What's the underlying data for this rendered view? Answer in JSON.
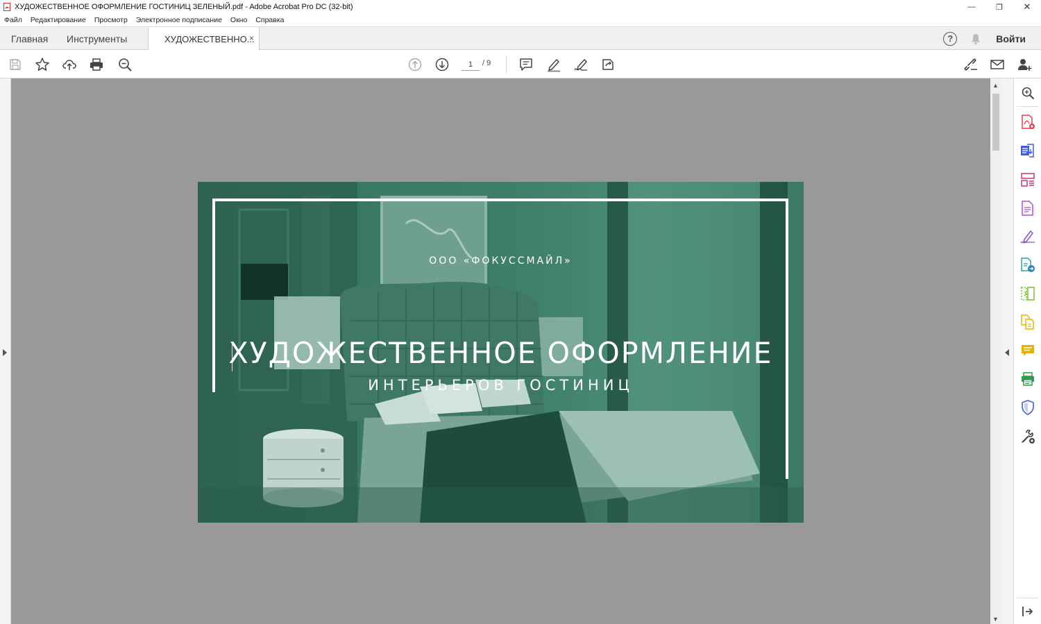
{
  "window": {
    "title": "ХУДОЖЕСТВЕННОЕ ОФОРМЛЕНИЕ ГОСТИНИЦ ЗЕЛЕНЫЙ.pdf - Adobe Acrobat Pro DC (32-bit)",
    "controls": {
      "minimize": "—",
      "restore": "❐",
      "close": "✕"
    }
  },
  "menu": [
    "Файл",
    "Редактирование",
    "Просмотр",
    "Электронное подписание",
    "Окно",
    "Справка"
  ],
  "tabs": {
    "home": "Главная",
    "tools": "Инструменты",
    "document": "ХУДОЖЕСТВЕННО...",
    "close": "×"
  },
  "header_right": {
    "help": "?",
    "login": "Войти"
  },
  "toolbar": {
    "page_current": "1",
    "page_total": "/ 9"
  },
  "pdf": {
    "company": "ООО «ФОКУССМАЙЛ»",
    "headline": "ХУДОЖЕСТВЕННОЕ ОФОРМЛЕНИЕ",
    "subhead": "ИНТЕРЬЕРОВ ГОСТИНИЦ"
  },
  "colors": {
    "accent_red": "#d9262c",
    "doc_bg": "#999999",
    "page_green": "#3a7a63"
  }
}
